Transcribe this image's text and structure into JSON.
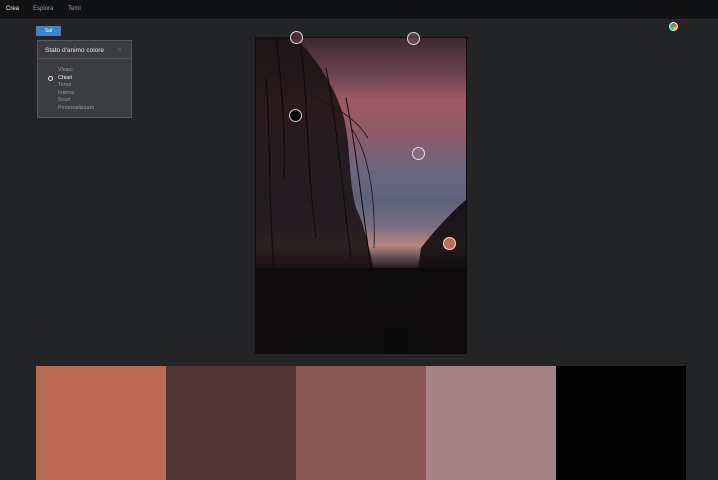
{
  "nav": {
    "items": [
      {
        "label": "Crea",
        "active": true
      },
      {
        "label": "Esplora",
        "active": false
      },
      {
        "label": "Temi",
        "active": false
      }
    ]
  },
  "icons": {
    "color_wheel": "color-wheel-icon",
    "toggle": "collapse-icon"
  },
  "action_button": {
    "label": "Sal"
  },
  "mood": {
    "title": "Stato d'animo colore",
    "toggle": "☆",
    "options": [
      "Vivaci",
      "Chiari",
      "Tenui",
      "Intensi",
      "Scuri",
      "Personalizzato"
    ],
    "selected": "Chiari"
  },
  "palette": {
    "swatches": [
      "#bb6b51",
      "#4f3433",
      "#8a5653",
      "#a58285",
      "#000000"
    ]
  },
  "pickers": [
    "#553237",
    "#8c5f69",
    "#050505",
    "#aa8c96",
    "#bd6d52"
  ]
}
